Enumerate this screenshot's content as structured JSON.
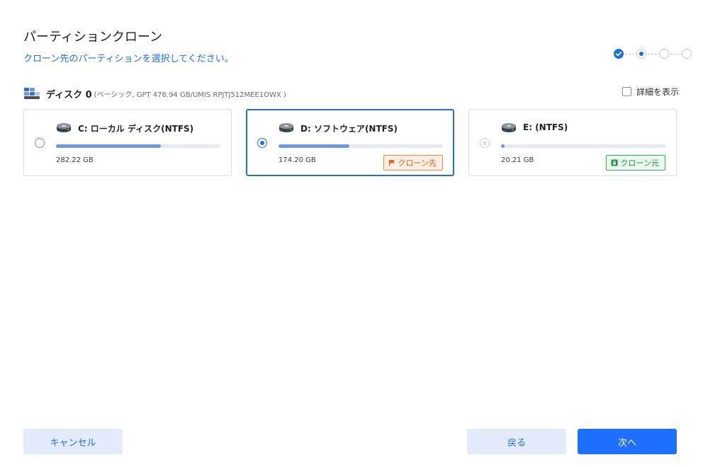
{
  "header": {
    "title": "パーティションクローン",
    "subtitle": "クローン先のパーティションを選択してください。"
  },
  "steps": {
    "total": 4,
    "completed": 1,
    "current": 2
  },
  "disk": {
    "name": "ディスク 0",
    "info": "(ベーシック, GPT 476.94 GB/UMIS RPJTJ512MEE1OWX )",
    "details_label": "詳細を表示",
    "details_checked": false
  },
  "partitions": [
    {
      "label": "C: ローカル ディスク(NTFS)",
      "size": "282.22 GB",
      "usage_fraction": 0.64,
      "state": "unselected",
      "badge": ""
    },
    {
      "label": "D: ソフトウェア(NTFS)",
      "size": "174.20 GB",
      "usage_fraction": 0.43,
      "state": "selected",
      "badge": "クローン先"
    },
    {
      "label": "E: (NTFS)",
      "size": "20.21 GB",
      "usage_fraction": 0.02,
      "state": "disabled",
      "badge": "クローン元"
    }
  ],
  "buttons": {
    "cancel": "キャンセル",
    "back": "戻る",
    "next": "次へ"
  },
  "colors": {
    "accent": "#1f6fdd",
    "primary_button": "#1f6fff",
    "secondary_button": "#e3ebfa",
    "usage_fill": "#6f99de",
    "target_badge": "#e2631b",
    "source_badge": "#1c8f41"
  },
  "icons": {
    "disk": "disk-stack-icon",
    "partition": "drive-icon",
    "target": "flag-icon",
    "source": "lock-icon"
  }
}
